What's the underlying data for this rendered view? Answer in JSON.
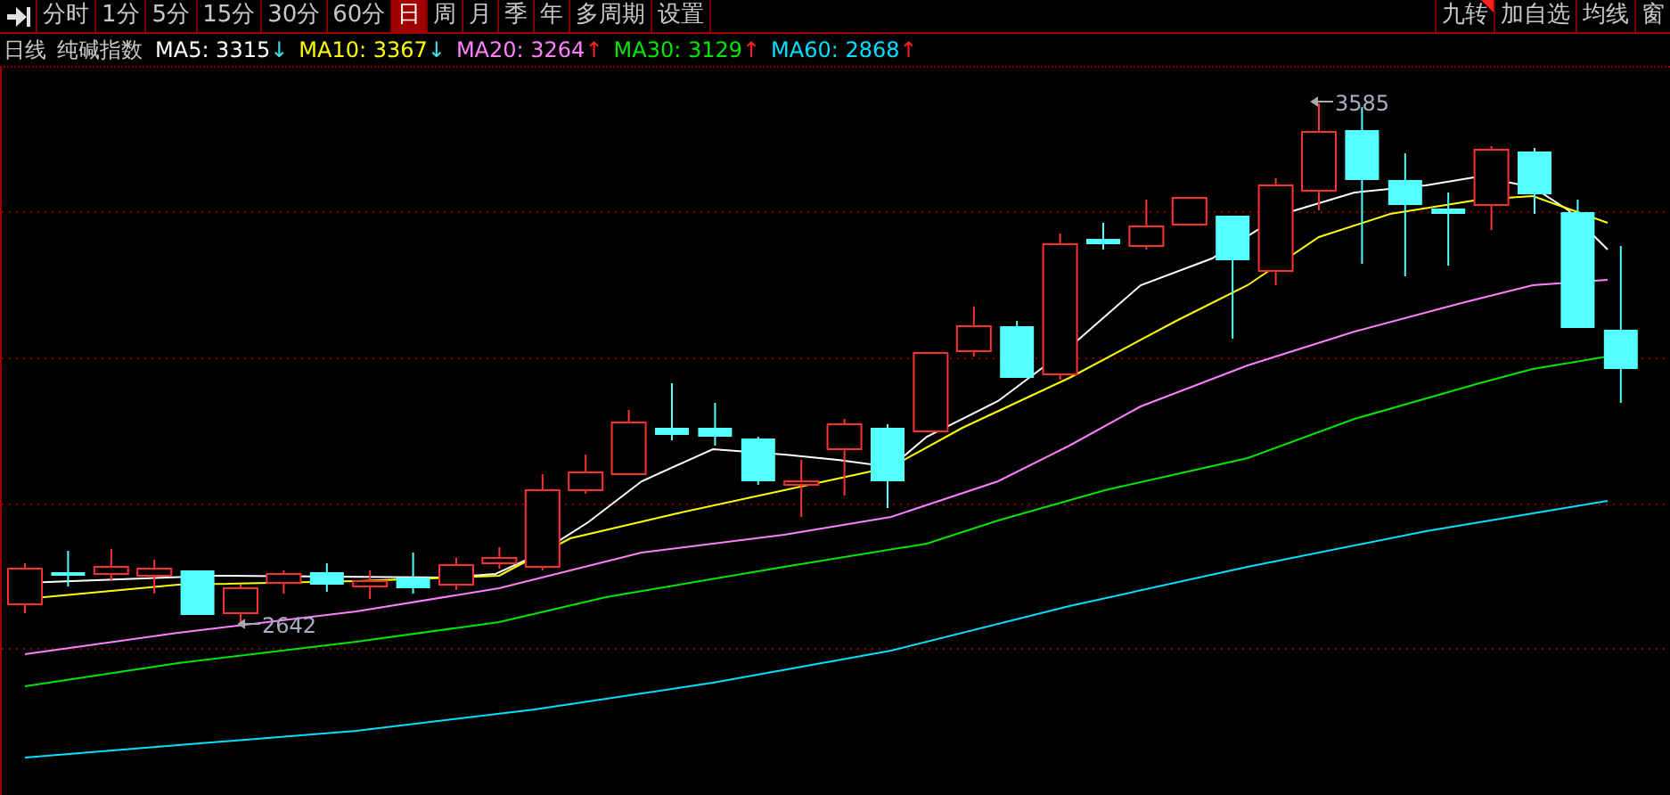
{
  "toolbar": {
    "left_tabs": [
      {
        "label": "分时",
        "selected": false
      },
      {
        "label": "1分",
        "selected": false
      },
      {
        "label": "5分",
        "selected": false
      },
      {
        "label": "15分",
        "selected": false
      },
      {
        "label": "30分",
        "selected": false
      },
      {
        "label": "60分",
        "selected": false
      },
      {
        "label": "日",
        "selected": true
      },
      {
        "label": "周",
        "selected": false
      },
      {
        "label": "月",
        "selected": false
      },
      {
        "label": "季",
        "selected": false
      },
      {
        "label": "年",
        "selected": false
      },
      {
        "label": "多周期",
        "selected": false
      },
      {
        "label": "设置",
        "selected": false
      }
    ],
    "right_buttons": [
      {
        "label": "九转",
        "flagged": true
      },
      {
        "label": "加自选",
        "flagged": false
      },
      {
        "label": "均线",
        "flagged": false
      },
      {
        "label": "窗",
        "flagged": false
      }
    ]
  },
  "legend": {
    "period": "日线",
    "instrument": "纯碱指数",
    "moving_averages": [
      {
        "label": "MA5: 3315",
        "color": "#ffffff",
        "arrow": {
          "symbol": "↓",
          "color": "#40e0e0"
        }
      },
      {
        "label": "MA10: 3367",
        "color": "#ffff00",
        "arrow": {
          "symbol": "↓",
          "color": "#40e0e0"
        }
      },
      {
        "label": "MA20: 3264",
        "color": "#ff80ff",
        "arrow": {
          "symbol": "↑",
          "color": "#ff2020"
        }
      },
      {
        "label": "MA30: 3129",
        "color": "#00e600",
        "arrow": {
          "symbol": "↑",
          "color": "#ff2020"
        }
      },
      {
        "label": "MA60: 2868",
        "color": "#00e0ff",
        "arrow": {
          "symbol": "↑",
          "color": "#ff2020"
        }
      }
    ]
  },
  "chart": {
    "high_label": "3585",
    "low_label": "2642"
  }
}
